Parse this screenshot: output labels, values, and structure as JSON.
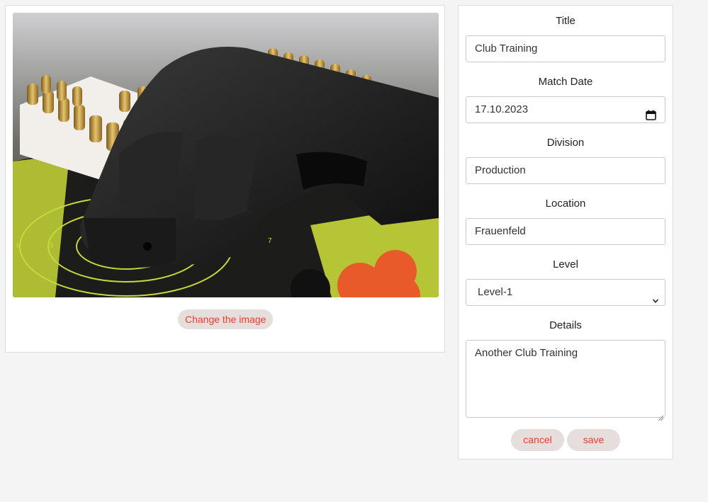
{
  "image_panel": {
    "change_image_label": "Change the image"
  },
  "form": {
    "title": {
      "label": "Title",
      "value": "Club Training"
    },
    "match_date": {
      "label": "Match Date",
      "value": "17.10.2023"
    },
    "division": {
      "label": "Division",
      "value": "Production"
    },
    "location": {
      "label": "Location",
      "value": "Frauenfeld"
    },
    "level": {
      "label": "Level",
      "value": "Level-1"
    },
    "details": {
      "label": "Details",
      "value": "Another Club Training"
    },
    "cancel_label": "cancel",
    "save_label": "save"
  },
  "icons": {
    "date": "calendar-icon",
    "select": "chevron-down-icon",
    "resize": "resize-grip-icon"
  },
  "colors": {
    "accent": "#e2412b",
    "button_bg": "#e5dedc",
    "page_bg": "#f4f4f4"
  }
}
